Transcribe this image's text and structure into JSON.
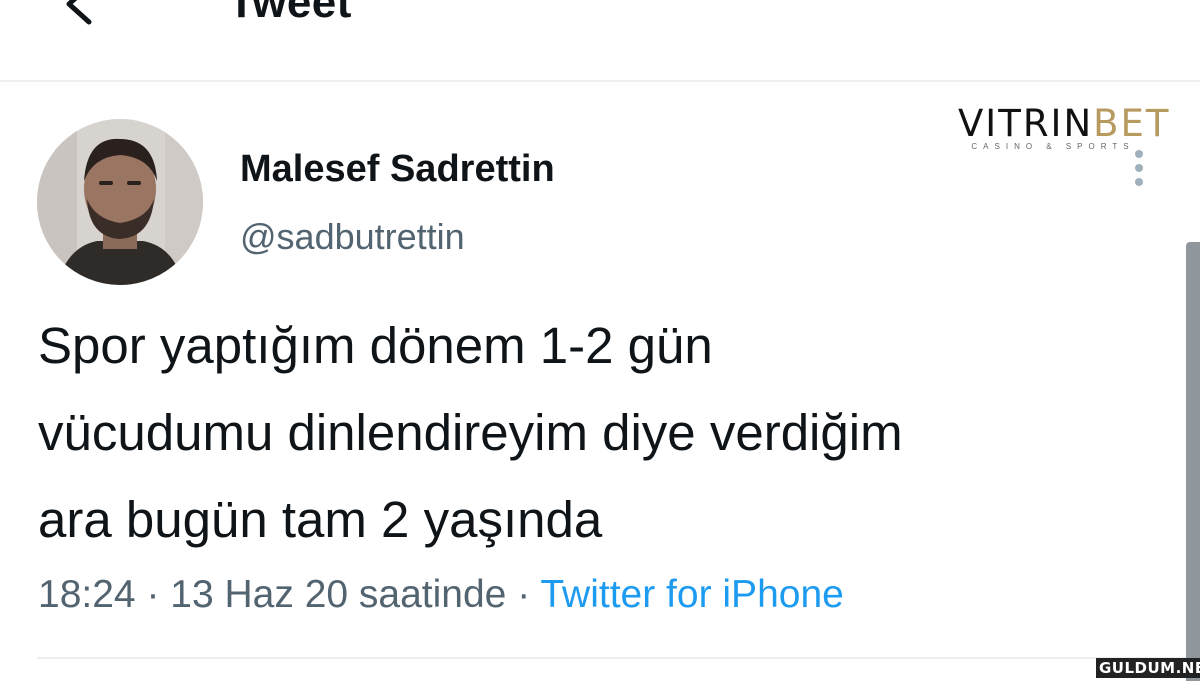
{
  "header": {
    "back_icon": "back-arrow-icon",
    "title": "Tweet"
  },
  "tweet": {
    "author": {
      "display_name": "Malesef Sadrettin",
      "handle": "@sadbutrettin"
    },
    "text_lines": [
      "Spor yaptığım dönem 1-2 gün",
      "vücudumu dinlendireyim diye verdiğim",
      "ara bugün tam 2 yaşında"
    ],
    "time": "18:24",
    "separator": "·",
    "date": "13 Haz 20 saatinde",
    "source": "Twitter for iPhone",
    "more_icon": "more-vertical-icon"
  },
  "logo": {
    "main": "VITRINBET",
    "main_left": "VITRIN",
    "main_right": "BET",
    "sub": "CASINO & SPORTS"
  },
  "watermark": "GULDUM.NET",
  "colors": {
    "link": "#1d9bf0",
    "secondary_text": "#536471",
    "primary_text": "#0f1419",
    "divider": "#eceff1"
  }
}
